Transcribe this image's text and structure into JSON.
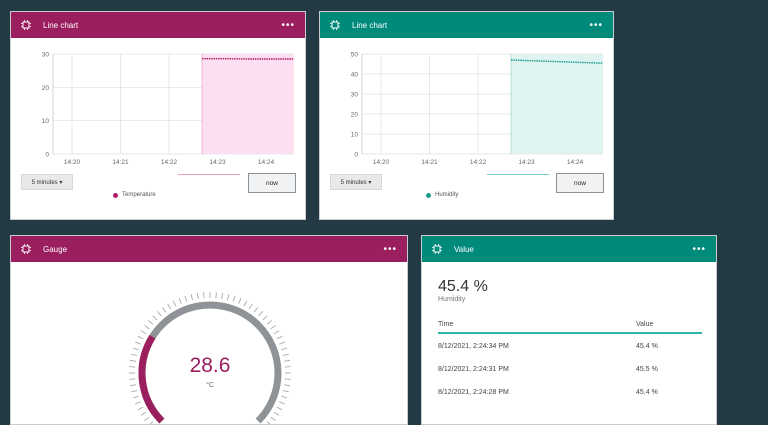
{
  "colors": {
    "temperature": "#9b1e5f",
    "humidity": "#008a79",
    "temp_fill": "#fcdff0",
    "hum_fill": "#dff4f0",
    "temp_line": "#b3196c",
    "hum_line": "#1d9c8c"
  },
  "card1": {
    "title": "Line chart",
    "menu": "•••",
    "icon": "chip-icon",
    "time_select": "5 minutes ▾",
    "now_button": "now",
    "legend": "Temperature",
    "chart_data": {
      "type": "area",
      "x_ticks": [
        "14:20",
        "14:21",
        "14:22",
        "14:23",
        "14:24"
      ],
      "y_ticks": [
        "0",
        "10",
        "20",
        "30"
      ],
      "ylim": [
        0,
        30
      ],
      "highlight_range": [
        "14:22.8",
        "14:24.6"
      ],
      "series": [
        {
          "name": "Temperature",
          "values": [
            28.6,
            28.6,
            28.5,
            28.5,
            28.5
          ]
        }
      ]
    }
  },
  "card2": {
    "title": "Line chart",
    "menu": "•••",
    "icon": "chip-icon",
    "time_select": "5 minutes ▾",
    "now_button": "now",
    "legend": "Humidity",
    "chart_data": {
      "type": "area",
      "x_ticks": [
        "14:20",
        "14:21",
        "14:22",
        "14:23",
        "14:24"
      ],
      "y_ticks": [
        "0",
        "10",
        "20",
        "30",
        "40",
        "50"
      ],
      "ylim": [
        0,
        50
      ],
      "highlight_range": [
        "14:22.8",
        "14:24.6"
      ],
      "series": [
        {
          "name": "Humidity",
          "values": [
            47.0,
            46.6,
            46.2,
            45.8,
            45.4
          ]
        }
      ]
    }
  },
  "card3": {
    "title": "Gauge",
    "menu": "•••",
    "icon": "chip-icon",
    "value": "28.6",
    "unit": "°C",
    "level_fraction": 0.286
  },
  "card4": {
    "title": "Value",
    "menu": "•••",
    "icon": "chip-icon",
    "value": "45.4 %",
    "label": "Humidity",
    "table": {
      "headers": [
        "Time",
        "Value"
      ],
      "rows": [
        [
          "8/12/2021, 2:24:34 PM",
          "45.4 %"
        ],
        [
          "8/12/2021, 2:24:31 PM",
          "45.5 %"
        ],
        [
          "8/12/2021, 2:24:28 PM",
          "45.4 %"
        ]
      ]
    }
  }
}
